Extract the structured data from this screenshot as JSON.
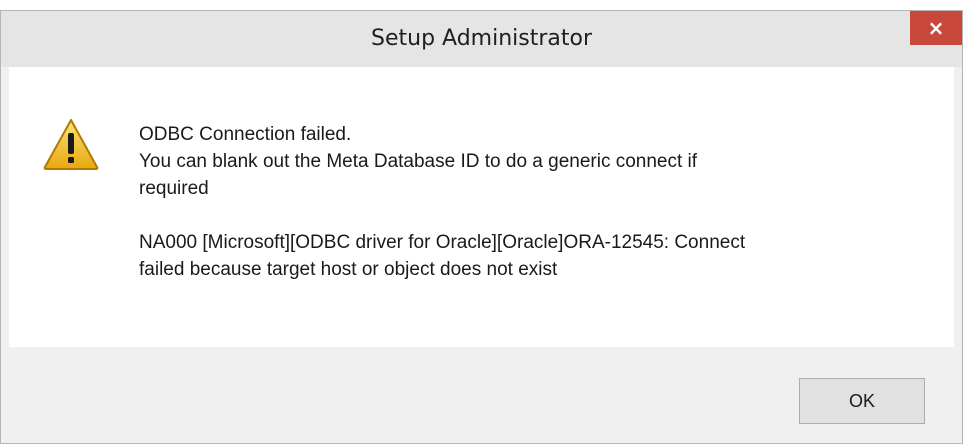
{
  "dialog": {
    "title": "Setup Administrator",
    "close_glyph": "×",
    "icon": "warning-icon",
    "message_line1": "ODBC Connection failed.",
    "message_line2": "You can blank out the Meta Database ID to do a generic connect if",
    "message_line3": "required",
    "message_line4": "NA000 [Microsoft][ODBC driver for Oracle][Oracle]ORA-12545: Connect",
    "message_line5": "failed because target host or object does not exist",
    "ok_label": "OK"
  },
  "colors": {
    "close_button": "#c9483c",
    "titlebar": "#e5e5e5",
    "content_bg": "#ffffff",
    "footer_bg": "#f0f0f0",
    "warning_fill": "#f2c230"
  }
}
